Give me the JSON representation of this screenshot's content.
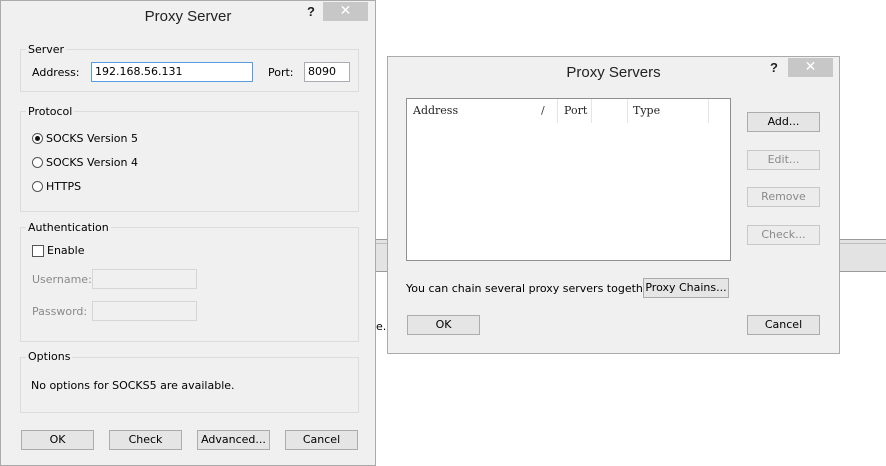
{
  "proxy_server": {
    "title": "Proxy Server",
    "help_label": "?",
    "close_label": "✕",
    "server": {
      "group_label": "Server",
      "address_label": "Address:",
      "address_value": "192.168.56.131",
      "port_label": "Port:",
      "port_value": "8090"
    },
    "protocol": {
      "group_label": "Protocol",
      "options": [
        {
          "label": "SOCKS Version 5",
          "selected": true
        },
        {
          "label": "SOCKS Version 4",
          "selected": false
        },
        {
          "label": "HTTPS",
          "selected": false
        }
      ]
    },
    "authentication": {
      "group_label": "Authentication",
      "enable_label": "Enable",
      "enabled": false,
      "username_label": "Username:",
      "username_value": "",
      "password_label": "Password:",
      "password_value": ""
    },
    "options": {
      "group_label": "Options",
      "message": "No options for SOCKS5 are available."
    },
    "buttons": {
      "ok": "OK",
      "check": "Check",
      "advanced": "Advanced...",
      "cancel": "Cancel"
    }
  },
  "proxy_servers": {
    "title": "Proxy Servers",
    "help_label": "?",
    "close_label": "✕",
    "columns": [
      "Address",
      "Port",
      "Type"
    ],
    "sort_indicator": "/",
    "rows": [],
    "buttons": {
      "add": "Add...",
      "edit": "Edit...",
      "remove": "Remove",
      "check": "Check...",
      "proxy_chains": "Proxy Chains...",
      "ok": "OK",
      "cancel": "Cancel"
    },
    "chain_text": "You can chain several proxy servers together:"
  },
  "background": {
    "stray_text": "e."
  }
}
